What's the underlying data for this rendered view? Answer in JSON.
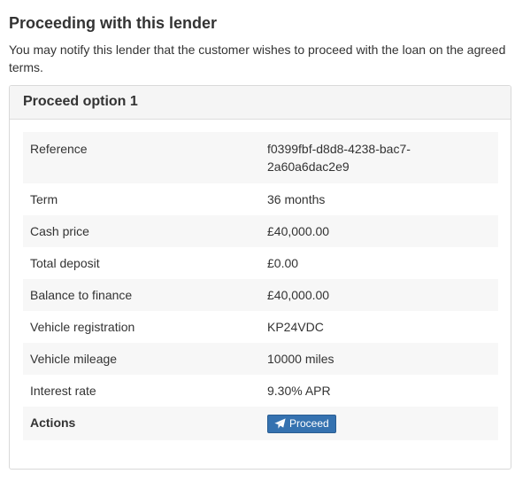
{
  "page": {
    "title": "Proceeding with this lender",
    "intro": "You may notify this lender that the customer wishes to proceed with the loan on the agreed terms."
  },
  "panel": {
    "title": "Proceed option 1"
  },
  "details": {
    "rows": [
      {
        "label": "Reference",
        "value": "f0399fbf-d8d8-4238-bac7-2a60a6dac2e9"
      },
      {
        "label": "Term",
        "value": "36 months"
      },
      {
        "label": "Cash price",
        "value": "£40,000.00"
      },
      {
        "label": "Total deposit",
        "value": "£0.00"
      },
      {
        "label": "Balance to finance",
        "value": "£40,000.00"
      },
      {
        "label": "Vehicle registration",
        "value": "KP24VDC"
      },
      {
        "label": "Vehicle mileage",
        "value": "10000 miles"
      },
      {
        "label": "Interest rate",
        "value": "9.30% APR"
      }
    ],
    "actions_label": "Actions",
    "proceed_button": {
      "label": "Proceed",
      "icon": "paper-plane-icon",
      "color": "#3572b0"
    }
  }
}
